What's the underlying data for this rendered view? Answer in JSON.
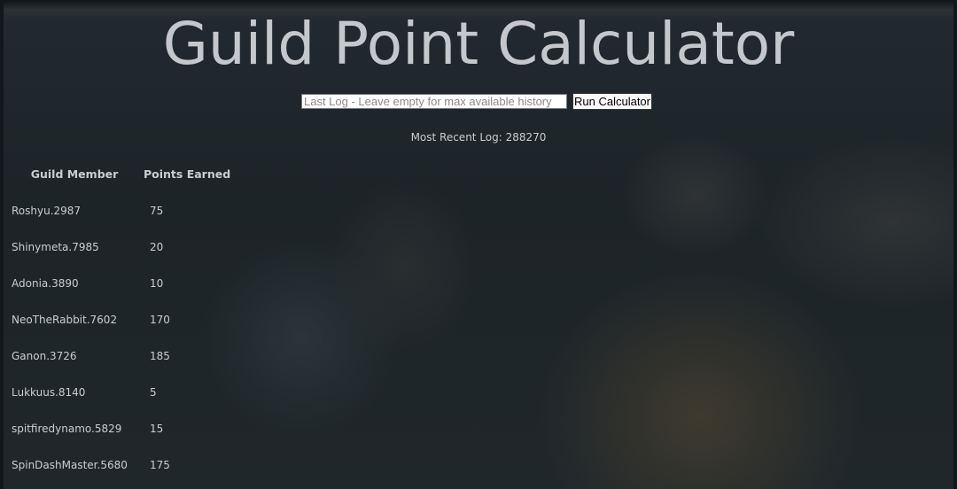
{
  "page": {
    "title": "Guild Point Calculator"
  },
  "controls": {
    "log_input_placeholder": "Last Log - Leave empty for max available history",
    "log_input_value": "",
    "run_button_label": "Run Calculator"
  },
  "status": {
    "most_recent_log": "Most Recent Log: 288270"
  },
  "table": {
    "headers": [
      "Guild Member",
      "Points Earned"
    ],
    "rows": [
      {
        "member": "Roshyu.2987",
        "points": "75"
      },
      {
        "member": "Shinymeta.7985",
        "points": "20"
      },
      {
        "member": "Adonia.3890",
        "points": "10"
      },
      {
        "member": "NeoTheRabbit.7602",
        "points": "170"
      },
      {
        "member": "Ganon.3726",
        "points": "185"
      },
      {
        "member": "Lukkuus.8140",
        "points": "5"
      },
      {
        "member": "spitfiredynamo.5829",
        "points": "15"
      },
      {
        "member": "SpinDashMaster.5680",
        "points": "175"
      }
    ]
  },
  "colors": {
    "background": "#1f262a",
    "text": "#c9cdd0",
    "title": "#c4c8cb"
  }
}
